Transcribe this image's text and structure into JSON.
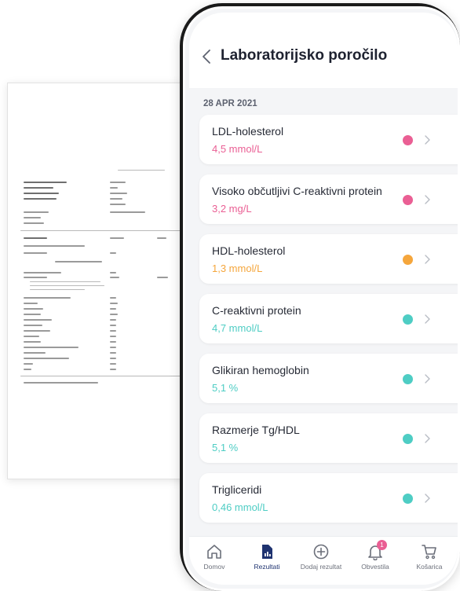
{
  "header": {
    "title": "Laboratorijsko poročilo"
  },
  "date": "28 APR 2021",
  "results": [
    {
      "name": "LDL-holesterol",
      "value": "4,5 mmol/L",
      "color": "#ea5f94"
    },
    {
      "name": "Visoko občutljivi C-reaktivni protein",
      "value": "3,2 mg/L",
      "color": "#ea5f94"
    },
    {
      "name": "HDL-holesterol",
      "value": "1,3 mmol/L",
      "color": "#f5a63c"
    },
    {
      "name": "C-reaktivni protein",
      "value": "4,7 mmol/L",
      "color": "#4ecdc4"
    },
    {
      "name": "Glikiran hemoglobin",
      "value": "5,1 %",
      "color": "#4ecdc4"
    },
    {
      "name": "Razmerje Tg/HDL",
      "value": "5,1 %",
      "color": "#4ecdc4"
    },
    {
      "name": "Trigliceridi",
      "value": "0,46 mmol/L",
      "color": "#4ecdc4"
    }
  ],
  "tabs": [
    {
      "label": "Domov",
      "icon": "home-icon"
    },
    {
      "label": "Rezultati",
      "icon": "results-icon"
    },
    {
      "label": "Dodaj rezultat",
      "icon": "plus-circle-icon"
    },
    {
      "label": "Obvestila",
      "icon": "bell-icon",
      "badge": "1"
    },
    {
      "label": "Košarica",
      "icon": "cart-icon"
    }
  ],
  "colors": {
    "accent": "#1f3370",
    "alert": "#ea5f94",
    "warning": "#f5a63c",
    "ok": "#4ecdc4"
  }
}
